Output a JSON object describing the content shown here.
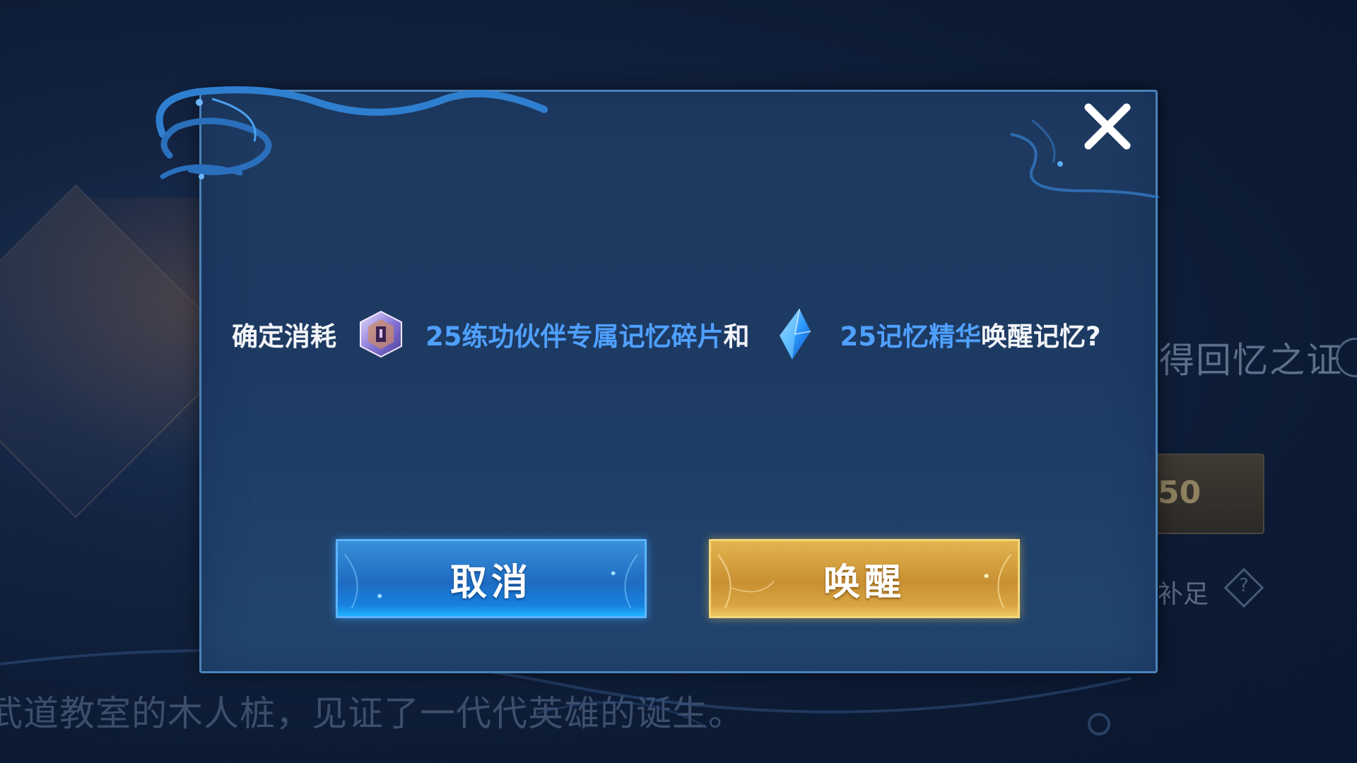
{
  "background": {
    "side_text": "得回忆之证",
    "side_number": "50",
    "side_fill_label": "补足",
    "side_help": "?",
    "bottom_text": "武道教室的木人桩，见证了一代代英雄的诞生。"
  },
  "dialog": {
    "close_icon": "close-icon",
    "message": {
      "prefix": "确定消耗",
      "fragment_icon": "memory-fragment-icon",
      "fragment_text": "25练功伙伴专属记忆碎片",
      "conjunction": "和",
      "essence_icon": "memory-essence-crystal-icon",
      "essence_text": "25记忆精华",
      "suffix": "唤醒记忆?"
    },
    "buttons": {
      "cancel_label": "取消",
      "confirm_label": "唤醒"
    }
  },
  "colors": {
    "highlight_blue": "#4fa0ff",
    "cancel_button": "#1f6cc2",
    "confirm_button": "#c89032",
    "dialog_bg": "#1e3a60"
  }
}
